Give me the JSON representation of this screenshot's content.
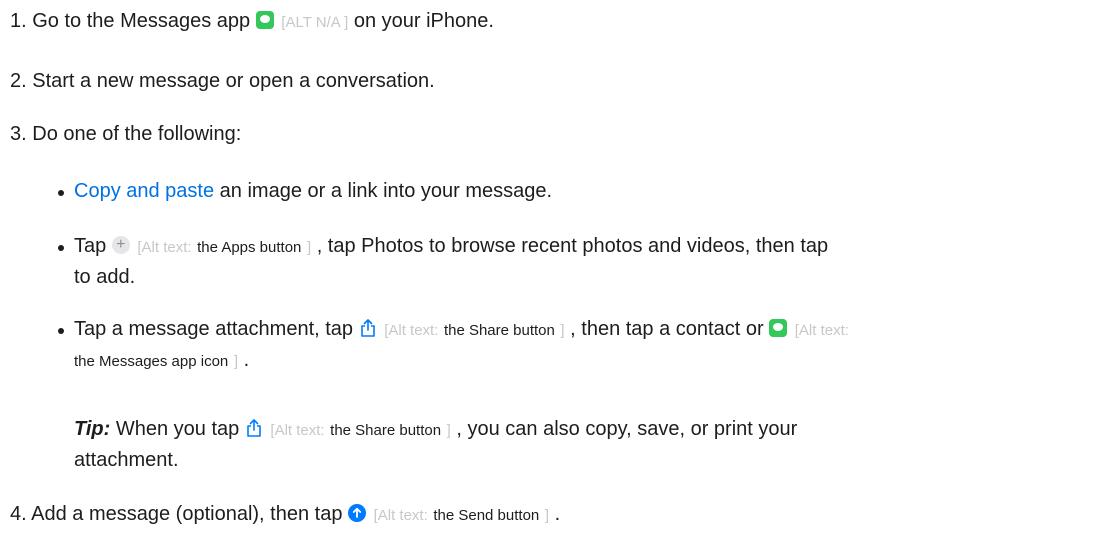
{
  "steps": [
    {
      "number": "1.",
      "text_before": "Go to the Messages app",
      "alt_placeholder": "[ALT N/A ]",
      "text_after": "on your iPhone."
    },
    {
      "number": "2.",
      "text": "Start a new message or open a conversation."
    },
    {
      "number": "3.",
      "text": "Do one of the following:"
    },
    {
      "number": "4.",
      "text_before": "Add a message (optional), then tap",
      "alt_prefix": "[Alt text:",
      "alt_body": "the Send button",
      "alt_suffix": "]",
      "text_after": "."
    }
  ],
  "bullets": [
    {
      "link_text": "Copy and paste",
      "text": "an image or a link into your message."
    },
    {
      "text_before": "Tap",
      "alt_prefix": "[Alt text:",
      "alt_body": "the Apps button",
      "alt_suffix": "]",
      "text_after": ", tap Photos to browse recent photos and videos, then tap",
      "text_line2": "to add."
    },
    {
      "text_before": "Tap a message attachment, tap",
      "alt_prefix_1": "[Alt text:",
      "alt_body_1": "the Share button",
      "alt_suffix_1": "]",
      "text_middle": ", then tap a contact or",
      "alt_prefix_2": "[Alt text:",
      "alt_body_2": "the Messages app icon",
      "alt_suffix_2": "]",
      "text_after": "."
    }
  ],
  "tip": {
    "label": "Tip:",
    "text_before": "When you tap",
    "alt_prefix": "[Alt text:",
    "alt_body": "the Share button",
    "alt_suffix": "]",
    "text_after": ", you can also copy, save, or print your",
    "text_line2": "attachment."
  },
  "icons": {
    "messages": "messages-app-icon",
    "apps": "plus-icon",
    "share": "share-icon",
    "send": "send-icon"
  },
  "colors": {
    "text": "#1d1d1f",
    "link": "#0071e3",
    "alt_muted": "#c7c7cc",
    "messages_green": "#34c759",
    "send_blue": "#007aff"
  }
}
